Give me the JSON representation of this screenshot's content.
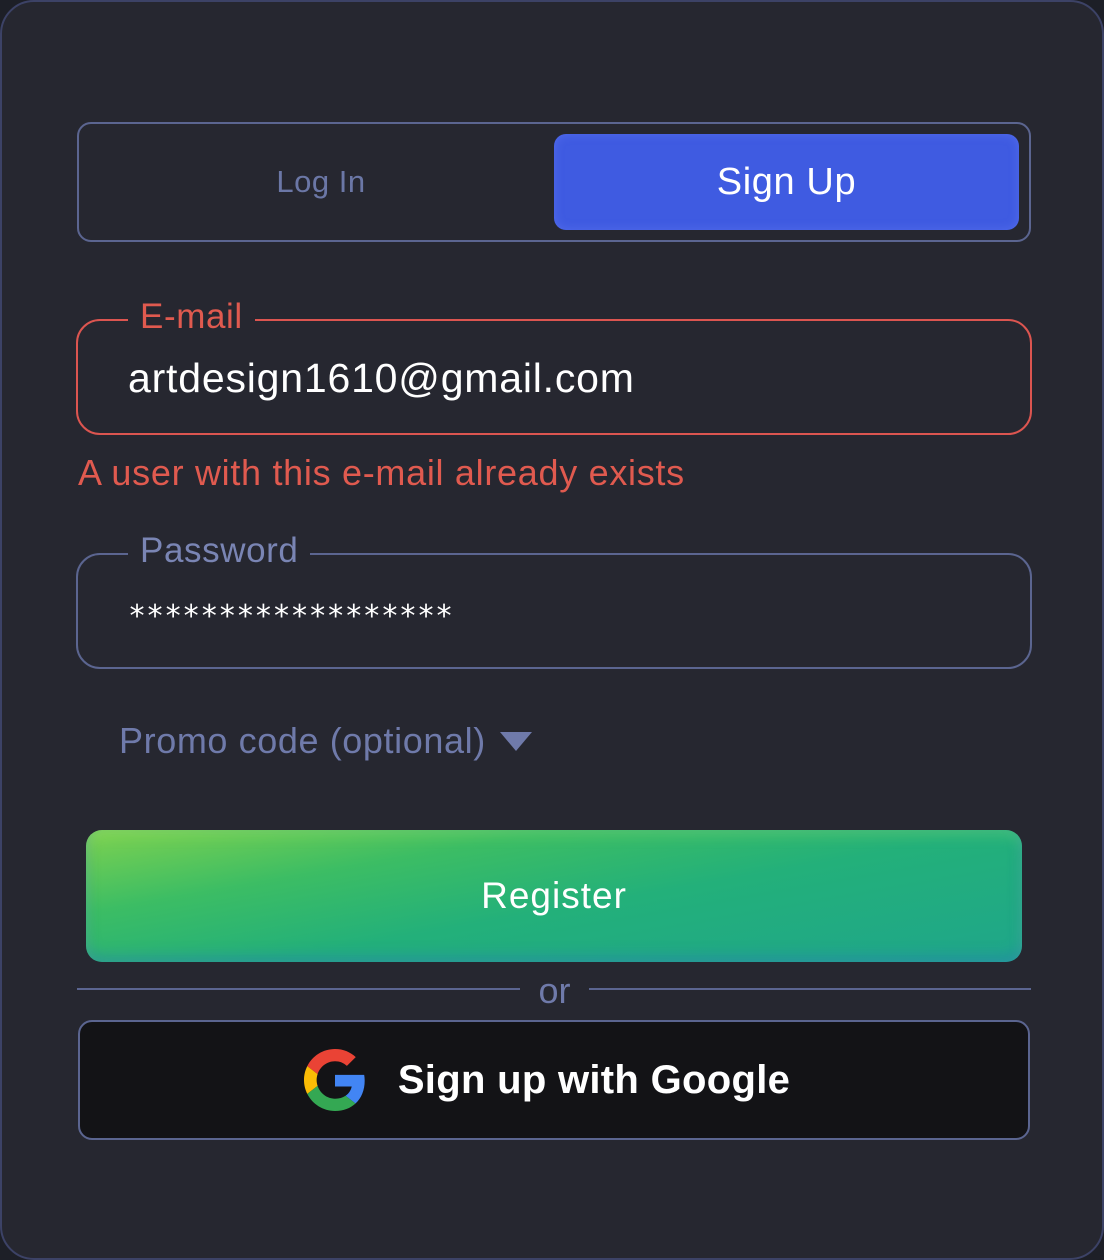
{
  "tabs": {
    "login_label": "Log In",
    "signup_label": "Sign Up",
    "active": "signup"
  },
  "email": {
    "label": "E-mail",
    "value": "artdesign1610@gmail.com",
    "error": "A user with this e-mail already exists"
  },
  "password": {
    "label": "Password",
    "value": "******************"
  },
  "promo": {
    "label": "Promo code (optional)",
    "icon": "caret-down-icon"
  },
  "register": {
    "label": "Register"
  },
  "divider": {
    "label": "or"
  },
  "google": {
    "label": "Sign up with Google",
    "icon": "google-icon"
  },
  "colors": {
    "card_bg": "#262730",
    "accent_blue": "#3f5be1",
    "error_red": "#e05a4f",
    "muted_text": "#6f7aaa",
    "border": "#5b6590",
    "register_green": "#23b07a"
  }
}
